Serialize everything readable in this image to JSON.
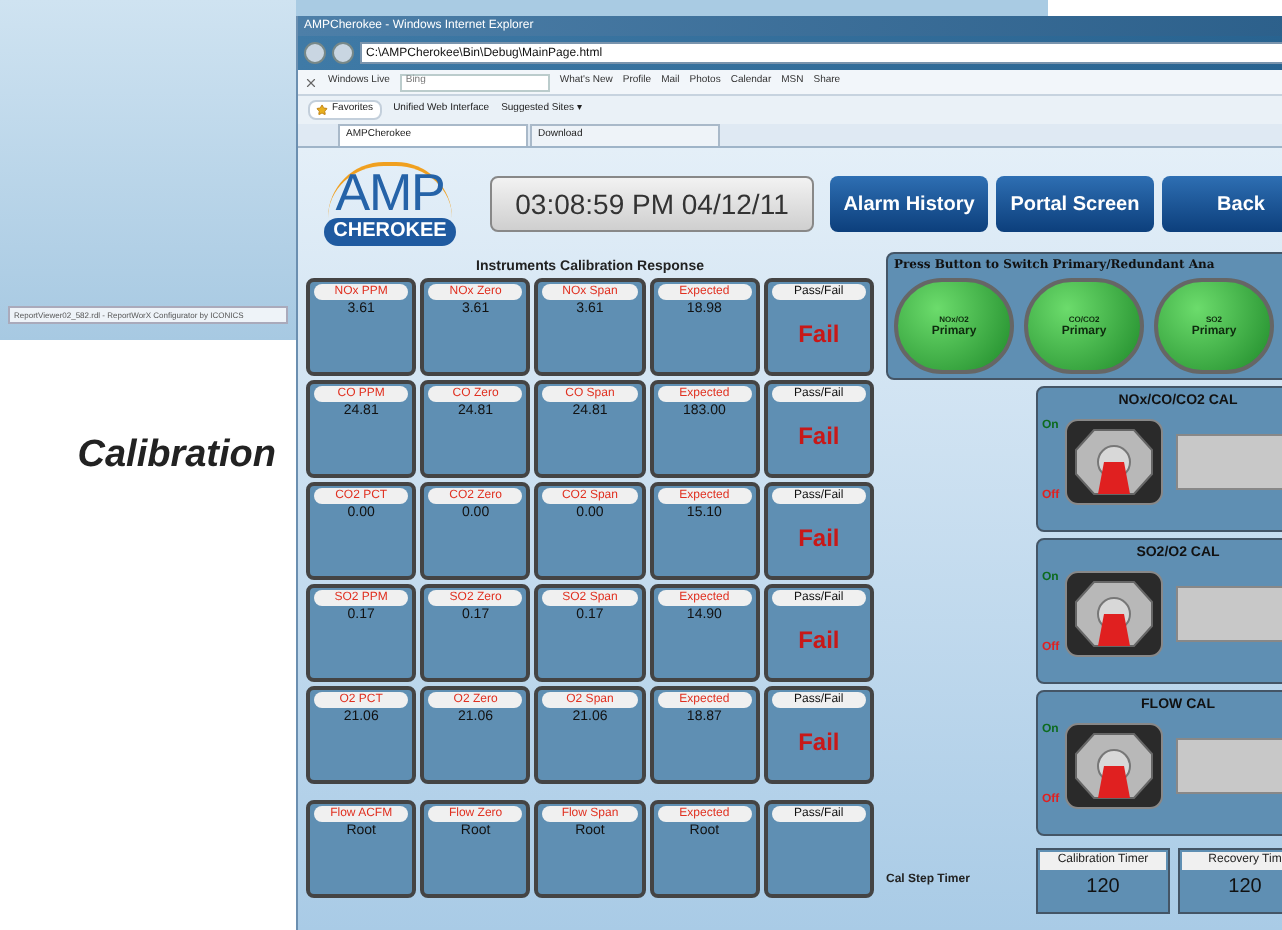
{
  "background_window": {
    "title": "ReportViewer02_582.rdl - ReportWorX Configurator by ICONICS"
  },
  "caption": "Calibration",
  "browser": {
    "title": "AMPCherokee - Windows Internet Explorer",
    "address": "C:\\AMPCherokee\\Bin\\Debug\\MainPage.html",
    "search_provider": "Windows Live",
    "search_value": "Bing",
    "links": [
      "What's New",
      "Profile",
      "Mail",
      "Photos",
      "Calendar",
      "MSN",
      "Share"
    ],
    "favorites": {
      "label": "Favorites",
      "items": [
        "Unified Web Interface",
        "Suggested Sites ▾"
      ]
    },
    "tabs": [
      {
        "label": "AMPCherokee",
        "selected": true
      },
      {
        "label": "Download",
        "selected": false
      }
    ]
  },
  "page": {
    "logo": {
      "top": "AMP",
      "bottom": "CHEROKEE"
    },
    "clock": "03:08:59 PM 04/12/11",
    "nav_buttons": [
      "Alarm History",
      "Portal Screen",
      "Back"
    ],
    "grid_title": "Instruments Calibration Response",
    "rows": [
      {
        "cells": [
          {
            "label": "NOx PPM",
            "value": "3.61"
          },
          {
            "label": "NOx Zero",
            "value": "3.61"
          },
          {
            "label": "NOx Span",
            "value": "3.61"
          },
          {
            "label": "Expected",
            "value": "18.98"
          }
        ],
        "result_label": "Pass/Fail",
        "result": "Fail"
      },
      {
        "cells": [
          {
            "label": "CO PPM",
            "value": "24.81"
          },
          {
            "label": "CO Zero",
            "value": "24.81"
          },
          {
            "label": "CO Span",
            "value": "24.81"
          },
          {
            "label": "Expected",
            "value": "183.00"
          }
        ],
        "result_label": "Pass/Fail",
        "result": "Fail"
      },
      {
        "cells": [
          {
            "label": "CO2 PCT",
            "value": "0.00"
          },
          {
            "label": "CO2 Zero",
            "value": "0.00"
          },
          {
            "label": "CO2 Span",
            "value": "0.00"
          },
          {
            "label": "Expected",
            "value": "15.10"
          }
        ],
        "result_label": "Pass/Fail",
        "result": "Fail"
      },
      {
        "cells": [
          {
            "label": "SO2 PPM",
            "value": "0.17"
          },
          {
            "label": "SO2 Zero",
            "value": "0.17"
          },
          {
            "label": "SO2 Span",
            "value": "0.17"
          },
          {
            "label": "Expected",
            "value": "14.90"
          }
        ],
        "result_label": "Pass/Fail",
        "result": "Fail"
      },
      {
        "cells": [
          {
            "label": "O2 PCT",
            "value": "21.06"
          },
          {
            "label": "O2 Zero",
            "value": "21.06"
          },
          {
            "label": "O2 Span",
            "value": "21.06"
          },
          {
            "label": "Expected",
            "value": "18.87"
          }
        ],
        "result_label": "Pass/Fail",
        "result": "Fail"
      },
      {
        "cells": [
          {
            "label": "Flow ACFM",
            "value": "Root"
          },
          {
            "label": "Flow Zero",
            "value": "Root"
          },
          {
            "label": "Flow Span",
            "value": "Root"
          },
          {
            "label": "Expected",
            "value": "Root"
          }
        ],
        "result_label": "Pass/Fail"
      }
    ],
    "switch_panel": {
      "title": "Press Button to Switch Primary/Redundant Ana",
      "buttons": [
        {
          "name": "NOx/O2",
          "state": "Primary"
        },
        {
          "name": "CO/CO2",
          "state": "Primary"
        },
        {
          "name": "SO2",
          "state": "Primary"
        }
      ]
    },
    "cal_panels": [
      {
        "title": "NOx/CO/CO2 CAL",
        "on_label": "On",
        "off_label": "Off",
        "on": false
      },
      {
        "title": "SO2/O2 CAL",
        "on_label": "On",
        "off_label": "Off",
        "on": false
      },
      {
        "title": "FLOW CAL",
        "on_label": "On",
        "off_label": "Off",
        "on": false
      }
    ],
    "timer": {
      "label": "Cal Step Timer",
      "timers": [
        {
          "label": "Calibration Timer",
          "value": "120"
        },
        {
          "label": "Recovery Tim",
          "value": "120"
        }
      ]
    }
  }
}
